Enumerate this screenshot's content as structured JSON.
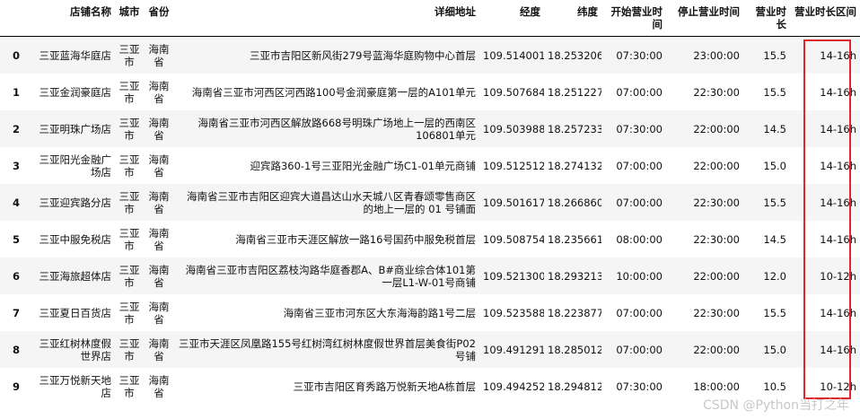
{
  "columns": [
    "",
    "店铺名称",
    "城市",
    "省份",
    "详细地址",
    "经度",
    "纬度",
    "开始营业时间",
    "停止营业时间",
    "营业时长",
    "营业时长区间"
  ],
  "rows": [
    [
      "0",
      "三亚蓝海华庭店",
      "三亚市",
      "海南省",
      "三亚市吉阳区新风街279号蓝海华庭购物中心首层",
      "109.514001",
      "18.253206",
      "07:30:00",
      "23:00:00",
      "15.5",
      "14-16h"
    ],
    [
      "1",
      "三亚金润豪庭店",
      "三亚市",
      "海南省",
      "海南省三亚市河西区河西路100号金润豪庭第一层的A101单元",
      "109.507684",
      "18.251227",
      "07:00:00",
      "22:30:00",
      "15.5",
      "14-16h"
    ],
    [
      "2",
      "三亚明珠广场店",
      "三亚市",
      "海南省",
      "海南省三亚市河西区解放路668号明珠广场地上一层的西南区106801单元",
      "109.503988",
      "18.257233",
      "07:30:00",
      "22:00:00",
      "14.5",
      "14-16h"
    ],
    [
      "3",
      "三亚阳光金融广场店",
      "三亚市",
      "海南省",
      "迎宾路360-1号三亚阳光金融广场C1-01单元商铺",
      "109.512512",
      "18.274132",
      "07:00:00",
      "22:00:00",
      "15.0",
      "14-16h"
    ],
    [
      "4",
      "三亚迎宾路分店",
      "三亚市",
      "海南省",
      "海南省三亚市吉阳区迎宾大道昌达山水天城八区青春颂零售商区的地上一层的 01 号铺面",
      "109.501617",
      "18.266860",
      "07:00:00",
      "22:30:00",
      "15.5",
      "14-16h"
    ],
    [
      "5",
      "三亚中服免税店",
      "三亚市",
      "海南省",
      "海南省三亚市天涯区解放一路16号国药中服免税首层",
      "109.508754",
      "18.235661",
      "08:00:00",
      "22:30:00",
      "14.5",
      "14-16h"
    ],
    [
      "6",
      "三亚海旅超体店",
      "三亚市",
      "海南省",
      "海南省三亚市吉阳区荔枝沟路华庭香郡A、B#商业综合体101第一层L1-W-01号商铺",
      "109.521300",
      "18.293213",
      "10:00:00",
      "22:00:00",
      "12.0",
      "10-12h"
    ],
    [
      "7",
      "三亚夏日百货店",
      "三亚市",
      "海南省",
      "海南省三亚市河东区大东海海韵路1号二层",
      "109.523588",
      "18.223877",
      "07:00:00",
      "22:30:00",
      "15.5",
      "14-16h"
    ],
    [
      "8",
      "三亚红树林度假世界店",
      "三亚市",
      "海南省",
      "三亚市天涯区凤凰路155号红树湾红树林度假世界首层美食街P02号铺",
      "109.491291",
      "18.285012",
      "07:00:00",
      "22:00:00",
      "15.0",
      "14-16h"
    ],
    [
      "9",
      "三亚万悦新天地店",
      "三亚市",
      "海南省",
      "三亚市吉阳区育秀路万悦新天地A栋首层",
      "109.494252",
      "18.294812",
      "07:30:00",
      "18:00:00",
      "10.5",
      "10-12h"
    ]
  ],
  "watermark": "CSDN @Python当打之年",
  "colors": {
    "highlight": "#e0252b",
    "row_stripe": "#f5f5f5"
  }
}
